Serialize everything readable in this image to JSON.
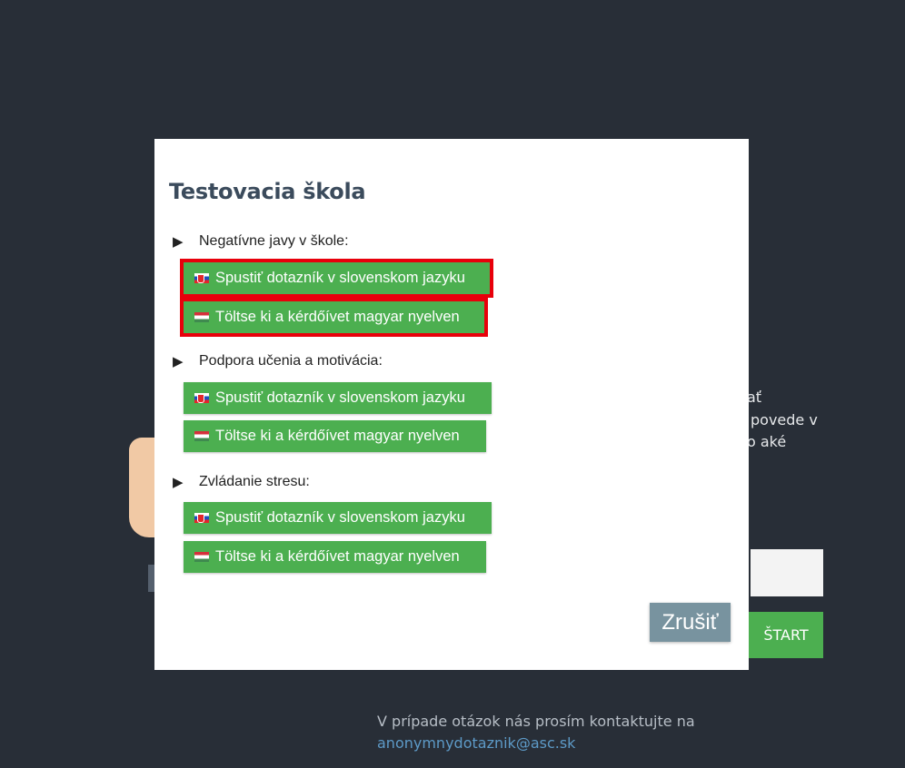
{
  "background": {
    "text_lines": [
      "ať",
      "povede v",
      "o aké"
    ],
    "start_button": "ŠTART",
    "contact_text": "V prípade otázok nás prosím kontaktujte na",
    "contact_email": "anonymnydotaznik@asc.sk"
  },
  "modal": {
    "title": "Testovacia škola",
    "sections": [
      {
        "label": "Negatívne javy v škole:",
        "buttons": [
          {
            "label": "Spustiť dotazník v slovenskom jazyku",
            "flag": "slovak-flag-icon"
          },
          {
            "label": "Töltse ki a kérdőívet magyar nyelven",
            "flag": "hungarian-flag-icon"
          }
        ]
      },
      {
        "label": "Podpora učenia a motivácia:",
        "buttons": [
          {
            "label": "Spustiť dotazník v slovenskom jazyku",
            "flag": "slovak-flag-icon"
          },
          {
            "label": "Töltse ki a kérdőívet magyar nyelven",
            "flag": "hungarian-flag-icon"
          }
        ]
      },
      {
        "label": "Zvládanie stresu:",
        "buttons": [
          {
            "label": "Spustiť dotazník v slovenskom jazyku",
            "flag": "slovak-flag-icon"
          },
          {
            "label": "Töltse ki a kérdőívet magyar nyelven",
            "flag": "hungarian-flag-icon"
          }
        ]
      }
    ],
    "cancel_label": "Zrušiť"
  },
  "colors": {
    "background": "#282e37",
    "button_green": "#4caf50",
    "highlight_red": "#e8000b",
    "cancel_gray": "#78939f",
    "title": "#3b4b5c"
  }
}
